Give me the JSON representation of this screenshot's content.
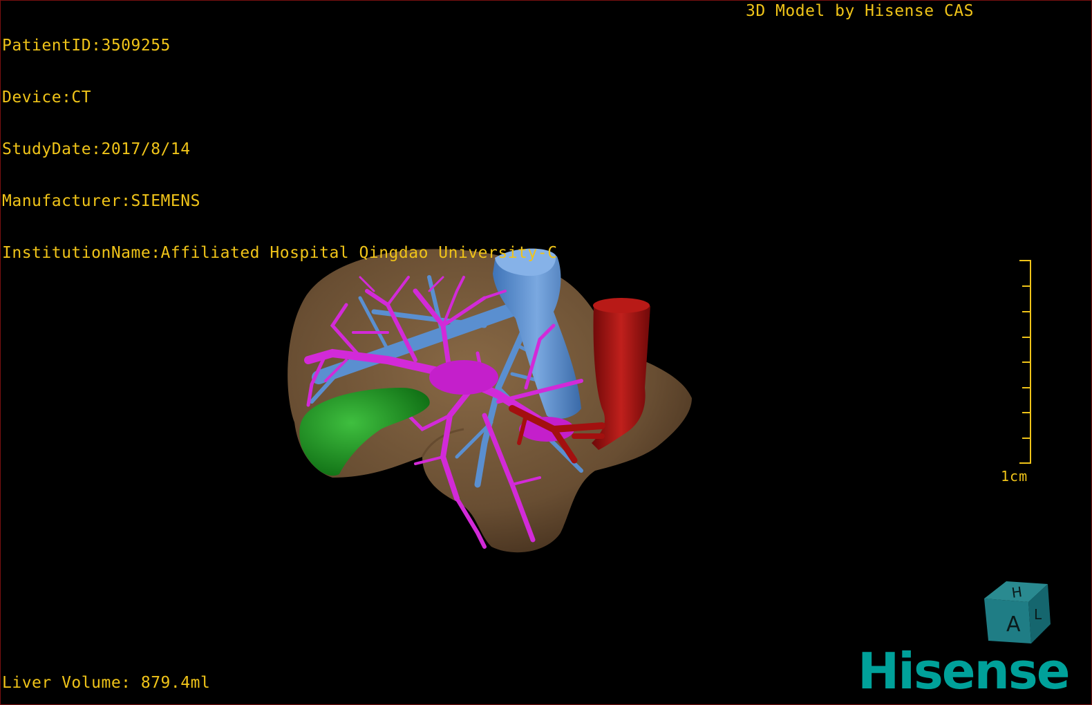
{
  "header": {
    "patient_id": "PatientID:3509255",
    "device": "Device:CT",
    "study_date": "StudyDate:2017/8/14",
    "manufacturer": "Manufacturer:SIEMENS",
    "institution": "InstitutionName:Affiliated Hospital Qingdao University-C",
    "title": "3D Model by Hisense CAS"
  },
  "footer": {
    "liver_volume": "Liver Volume: 879.4ml"
  },
  "scale": {
    "label": "1cm"
  },
  "orientation_cube": {
    "front_label": "A",
    "top_label": "H",
    "side_label": "L"
  },
  "brand": {
    "name": "Hisense"
  },
  "colors": {
    "overlay_text": "#f0c419",
    "liver": "#8a6a45",
    "portal_vein": "#d22ad8",
    "hepatic_vein": "#5a8fd0",
    "artery": "#a3100f",
    "gallbladder": "#1e9a1e",
    "brand": "#00a19a"
  }
}
